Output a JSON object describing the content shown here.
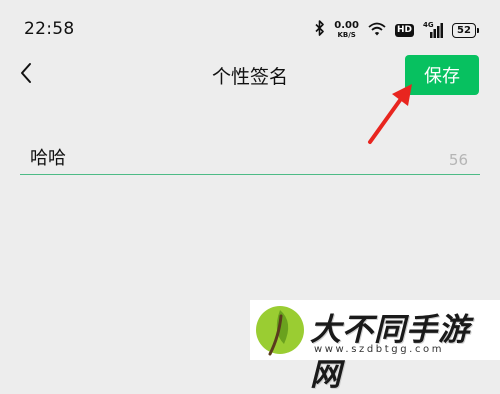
{
  "status_bar": {
    "time": "22:58",
    "net_speed_value": "0.00",
    "net_speed_unit": "KB/S",
    "hd_label": "HD",
    "network_label": "4G",
    "battery_level": "52"
  },
  "nav": {
    "title": "个性签名",
    "save_label": "保存"
  },
  "signature": {
    "value": "哈哈",
    "remaining_chars": "56"
  },
  "watermark": {
    "title": "大不同手游网",
    "url": "www.szdbtgg.com"
  },
  "colors": {
    "accent_green": "#07c160",
    "underline": "#4dbb86",
    "annotation_red": "#e8251f",
    "background": "#ededed"
  }
}
